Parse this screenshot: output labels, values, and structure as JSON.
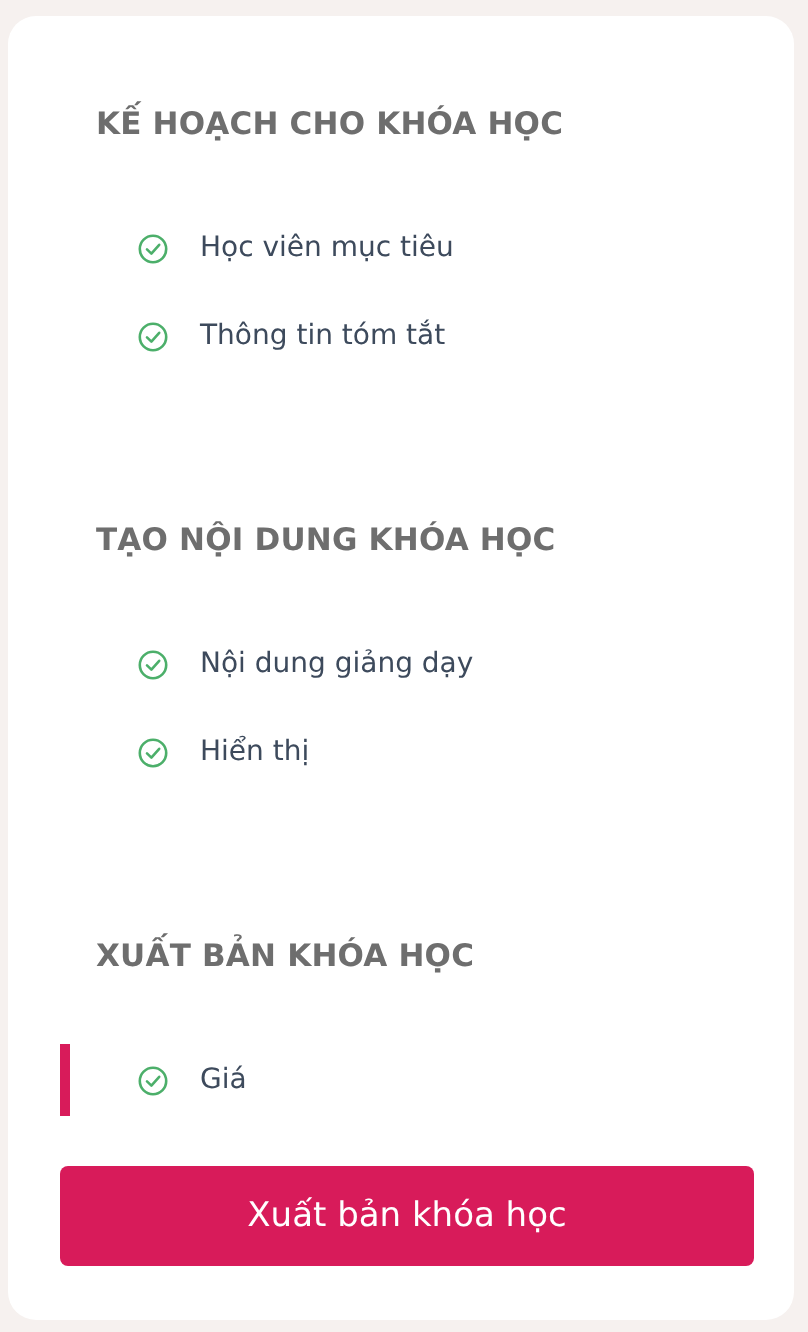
{
  "sections": [
    {
      "heading": "KẾ HOẠCH CHO KHÓA HỌC",
      "items": [
        {
          "label": "Học viên mục tiêu",
          "checked": true,
          "selected": false
        },
        {
          "label": "Thông tin tóm tắt",
          "checked": true,
          "selected": false
        }
      ]
    },
    {
      "heading": "TẠO NỘI DUNG KHÓA HỌC",
      "items": [
        {
          "label": "Nội dung giảng dạy",
          "checked": true,
          "selected": false
        },
        {
          "label": "Hiển thị",
          "checked": true,
          "selected": false
        }
      ]
    },
    {
      "heading": "XUẤT BẢN KHÓA HỌC",
      "items": [
        {
          "label": "Giá",
          "checked": true,
          "selected": true
        }
      ]
    }
  ],
  "publish_button": "Xuất bản khóa học"
}
